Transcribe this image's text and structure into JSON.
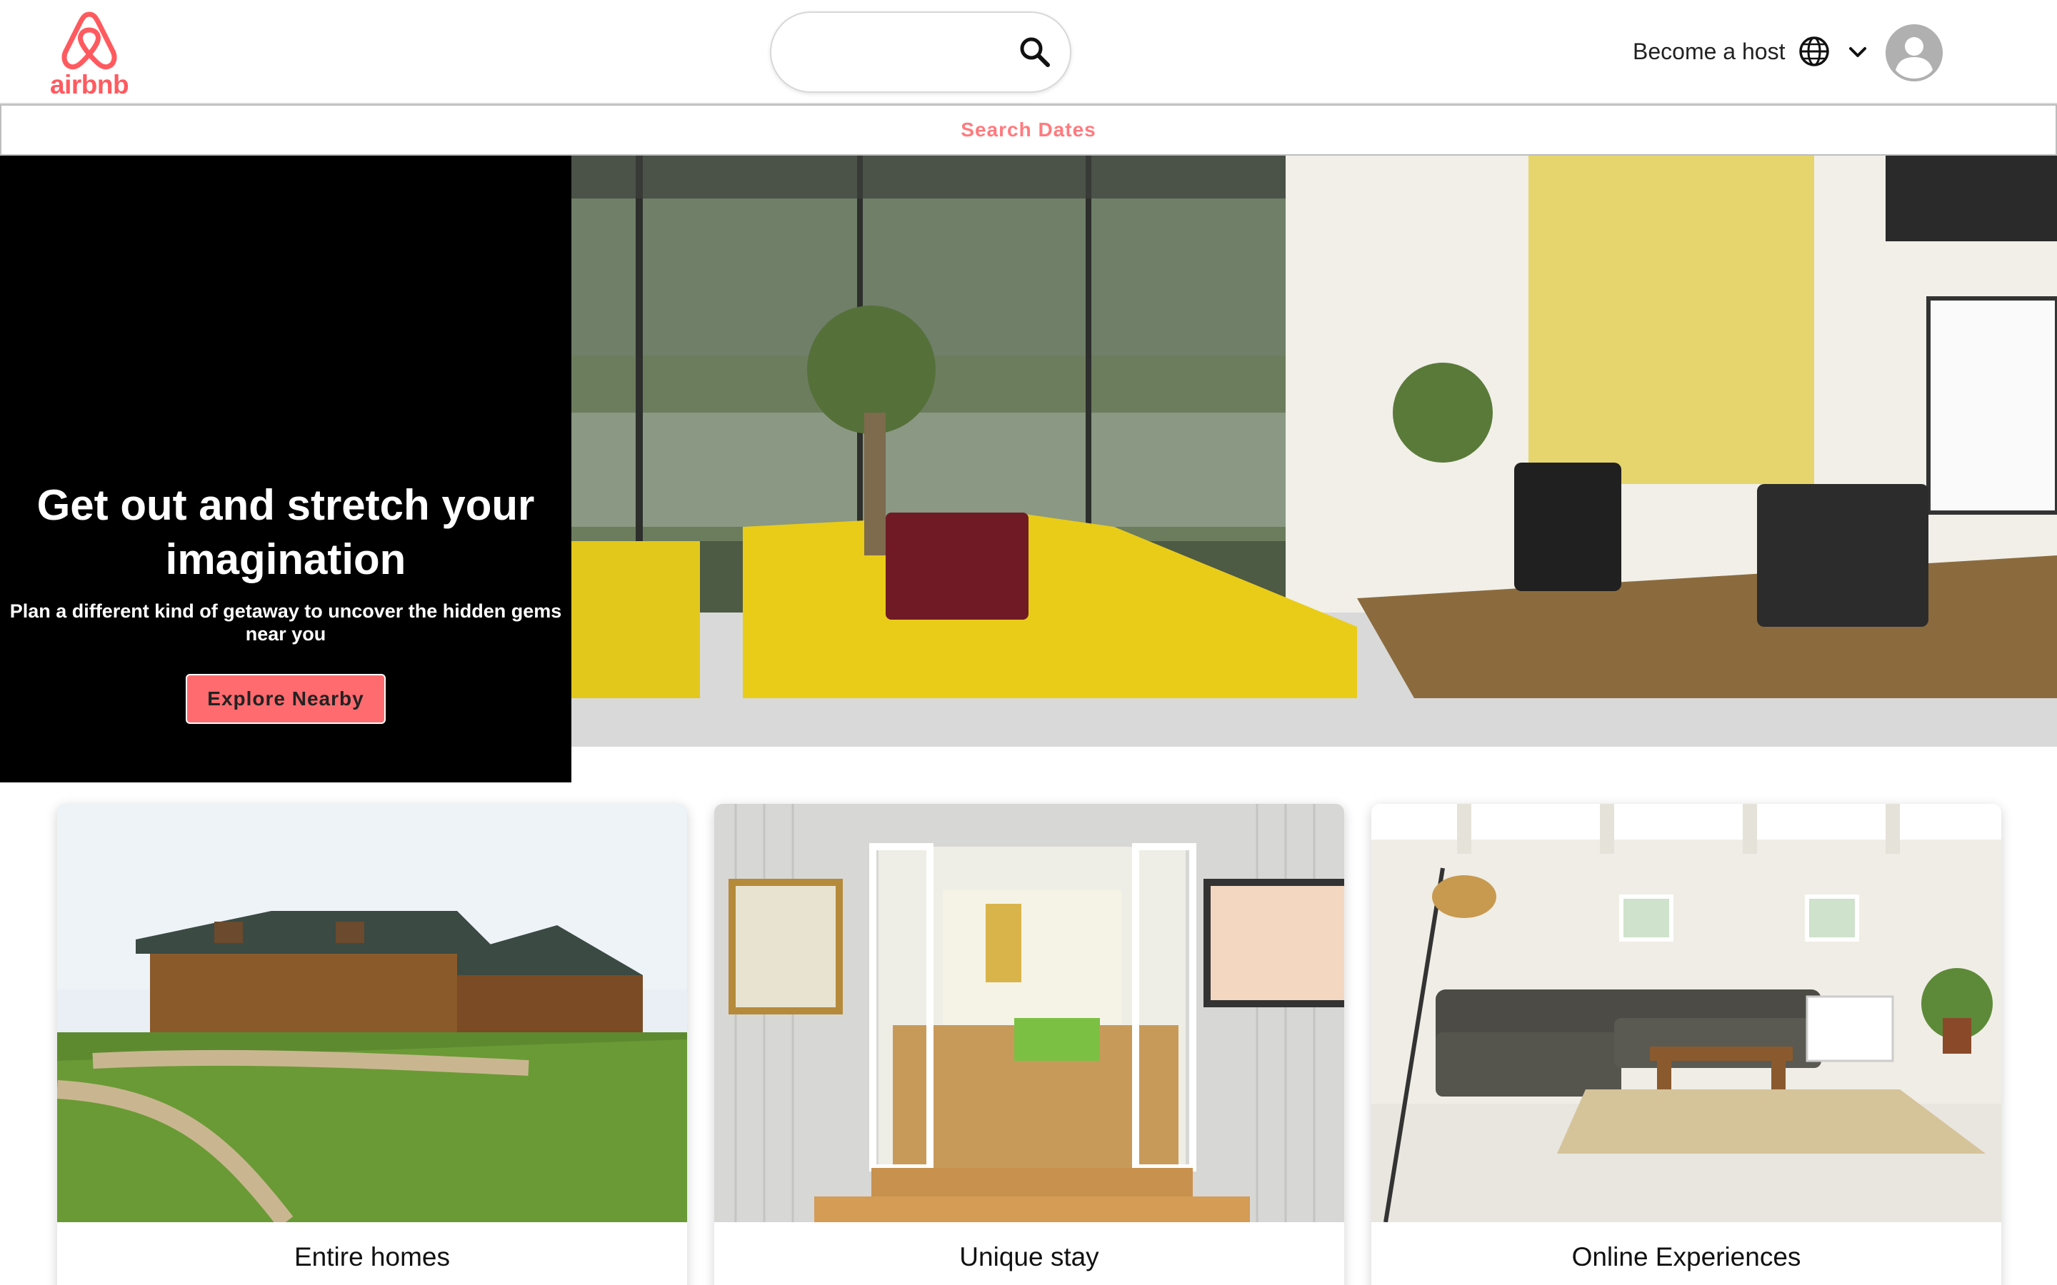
{
  "brand": {
    "name": "airbnb",
    "color": "#ff5a5f"
  },
  "header": {
    "search_placeholder": "",
    "host_link": "Become a host",
    "icons": [
      "search-icon",
      "globe-icon",
      "chevron-down-icon",
      "user-avatar-icon"
    ]
  },
  "dates_bar": {
    "label": "Search Dates"
  },
  "hero": {
    "title": "Get out and stretch your imagination",
    "subtitle": "Plan a different kind of getaway to uncover the hidden gems near you",
    "button": "Explore Nearby",
    "button_color": "#ff6b6f"
  },
  "categories": [
    {
      "label": "Entire homes"
    },
    {
      "label": "Unique stay"
    },
    {
      "label": "Online Experiences"
    }
  ]
}
